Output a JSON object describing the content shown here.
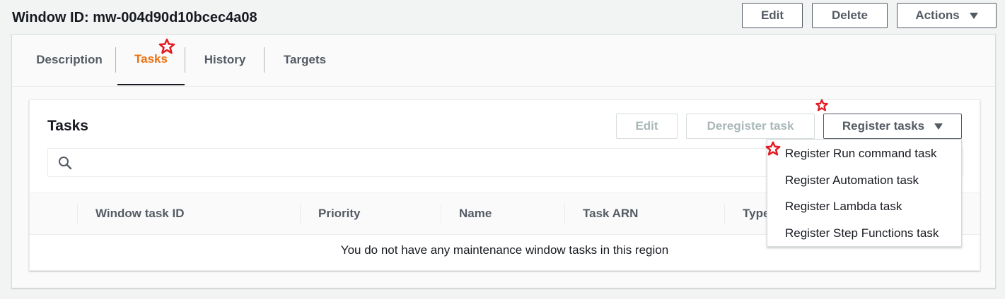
{
  "header": {
    "title": "Window ID: mw-004d90d10bcec4a08",
    "edit_label": "Edit",
    "delete_label": "Delete",
    "actions_label": "Actions"
  },
  "tabs": [
    {
      "label": "Description",
      "active": false
    },
    {
      "label": "Tasks",
      "active": true
    },
    {
      "label": "History",
      "active": false
    },
    {
      "label": "Targets",
      "active": false
    }
  ],
  "tasks_panel": {
    "title": "Tasks",
    "edit_label": "Edit",
    "deregister_label": "Deregister task",
    "register_label": "Register tasks",
    "columns": [
      "Window task ID",
      "Priority",
      "Name",
      "Task ARN",
      "Type"
    ],
    "empty_message": "You do not have any maintenance window tasks in this region"
  },
  "register_menu": {
    "items": [
      "Register Run command task",
      "Register Automation task",
      "Register Lambda task",
      "Register Step Functions task"
    ]
  },
  "colors": {
    "active_tab": "#ec7211",
    "marker": "#e31b23"
  },
  "icons": {
    "search": "search-icon",
    "caret": "caret-down-icon",
    "marker": "star-marker-icon"
  }
}
